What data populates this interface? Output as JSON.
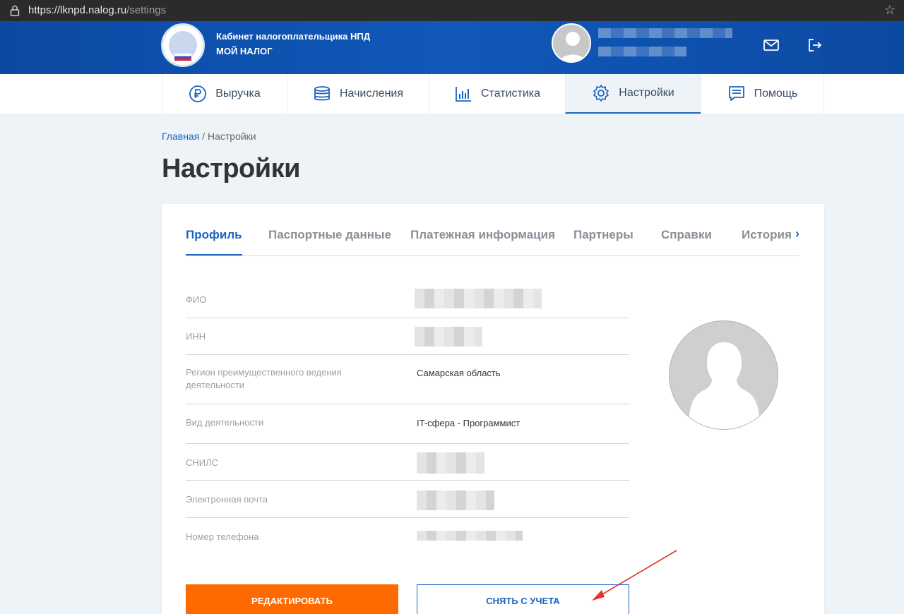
{
  "browser": {
    "url_host": "https://lknpd.nalog.ru",
    "url_path": "/settings"
  },
  "header": {
    "title_line1": "Кабинет налогоплательщика НПД",
    "title_line2": "МОЙ НАЛОГ",
    "icons": [
      "mail-icon",
      "logout-icon"
    ]
  },
  "nav": {
    "items": [
      {
        "label": "Выручка",
        "icon": "ruble-icon"
      },
      {
        "label": "Начисления",
        "icon": "coins-icon"
      },
      {
        "label": "Статистика",
        "icon": "bar-chart-icon"
      },
      {
        "label": "Настройки",
        "icon": "gear-icon",
        "active": true
      },
      {
        "label": "Помощь",
        "icon": "help-message-icon"
      }
    ]
  },
  "breadcrumb": {
    "home": "Главная",
    "separator": " / ",
    "current": "Настройки"
  },
  "page": {
    "title": "Настройки"
  },
  "tabs": {
    "items": [
      {
        "label": "Профиль",
        "active": true
      },
      {
        "label": "Паспортные данные"
      },
      {
        "label": "Платежная информация"
      },
      {
        "label": "Партнеры"
      },
      {
        "label": "Справки"
      },
      {
        "label": "История"
      }
    ],
    "more_icon": "chevron-right-icon"
  },
  "profile": {
    "fields": [
      {
        "label": "ФИО",
        "value": ""
      },
      {
        "label": "ИНН",
        "value": ""
      },
      {
        "label": "Регион преимущественного ведения деятельности",
        "value": "Самарская область"
      },
      {
        "label": "Вид деятельности",
        "value": "IT-сфера - Программист"
      },
      {
        "label": "СНИЛС",
        "value": ""
      },
      {
        "label": "Электронная почта",
        "value": ""
      },
      {
        "label": "Номер телефона",
        "value": ""
      }
    ]
  },
  "actions": {
    "edit_label": "РЕДАКТИРОВАТЬ",
    "deregister_label": "СНЯТЬ С УЧЕТА"
  },
  "colors": {
    "brand_blue": "#1a64c0",
    "header_blue": "#0b4aa3",
    "accent_orange": "#ff6a00",
    "annotation_red": "#e0332b"
  }
}
